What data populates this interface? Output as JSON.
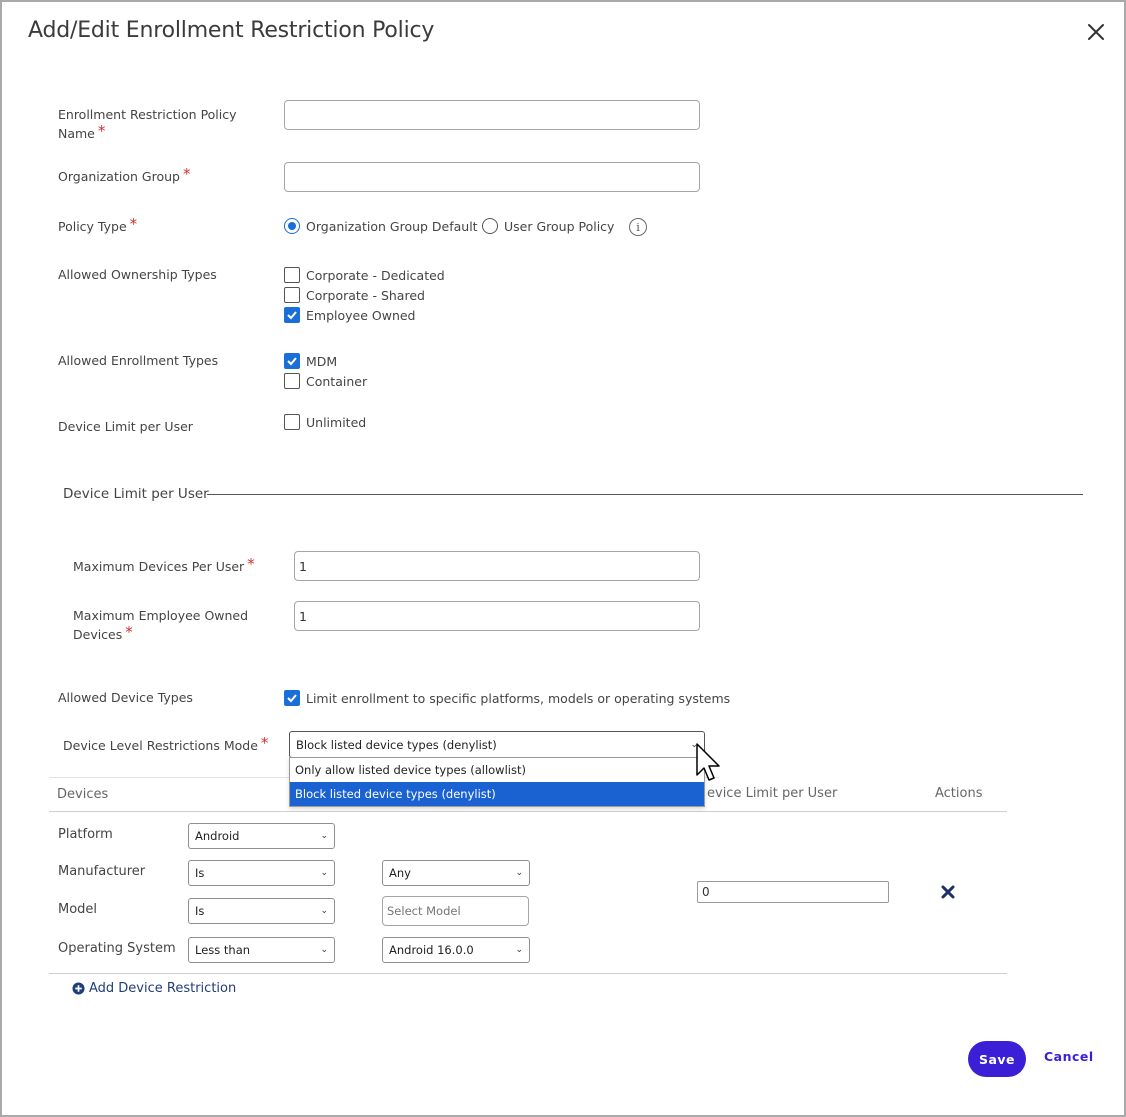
{
  "dialog": {
    "title": "Add/Edit Enrollment Restriction Policy",
    "save_label": "Save",
    "cancel_label": "Cancel"
  },
  "form": {
    "policy_name": {
      "label": "Enrollment Restriction Policy Name",
      "required": "*",
      "value": ""
    },
    "org_group": {
      "label": "Organization Group",
      "required": "*",
      "value": ""
    },
    "policy_type": {
      "label": "Policy Type",
      "required": "*",
      "options": [
        "Organization Group Default",
        "User Group Policy"
      ],
      "selected": "Organization Group Default"
    },
    "ownership_types": {
      "label": "Allowed Ownership Types",
      "options": [
        {
          "label": "Corporate - Dedicated",
          "checked": false
        },
        {
          "label": "Corporate - Shared",
          "checked": false
        },
        {
          "label": "Employee Owned",
          "checked": true
        }
      ]
    },
    "enrollment_types": {
      "label": "Allowed Enrollment Types",
      "options": [
        {
          "label": "MDM",
          "checked": true
        },
        {
          "label": "Container",
          "checked": false
        }
      ]
    },
    "device_limit": {
      "label": "Device Limit per User",
      "unlimited_label": "Unlimited",
      "unlimited_checked": false
    }
  },
  "device_limit_section": {
    "title": "Device Limit per User",
    "max_devices": {
      "label": "Maximum Devices Per User",
      "required": "*",
      "value": "1"
    },
    "max_employee_owned": {
      "label": "Maximum Employee Owned Devices",
      "required": "*",
      "value": "1"
    }
  },
  "allowed_device_types": {
    "label": "Allowed Device Types",
    "checkbox_label": "Limit enrollment to specific platforms, models or operating systems",
    "checked": true
  },
  "restrictions_mode": {
    "label": "Device Level Restrictions Mode",
    "required": "*",
    "value": "Block listed device types (denylist)",
    "options": [
      "Only allow listed device types (allowlist)",
      "Block listed device types (denylist)"
    ]
  },
  "table": {
    "headers": {
      "devices": "Devices",
      "limit": "evice Limit per User",
      "actions": "Actions"
    },
    "row": {
      "platform": {
        "label": "Platform",
        "value": "Android"
      },
      "manufacturer": {
        "label": "Manufacturer",
        "operator": "Is",
        "value": "Any"
      },
      "model": {
        "label": "Model",
        "operator": "Is",
        "placeholder": "Select Model"
      },
      "os": {
        "label": "Operating System",
        "operator": "Less than",
        "value": "Android 16.0.0"
      },
      "device_limit_value": "0"
    },
    "add_label": "Add Device Restriction"
  },
  "colors": {
    "accent": "#1a6ed8",
    "primary_button": "#3b1fd6",
    "required": "#d32f2f",
    "dropdown_selected": "#1a62d1"
  }
}
